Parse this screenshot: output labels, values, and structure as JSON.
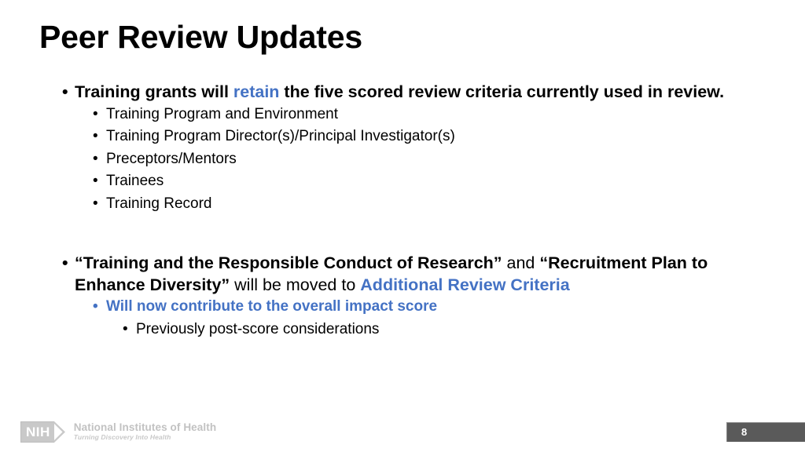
{
  "slide": {
    "title": "Peer Review Updates",
    "accent_color": "#4472C4",
    "text_color": "#000000",
    "background": "#FFFFFF"
  },
  "content": {
    "bullet1": {
      "part1": "Training grants will ",
      "accent": "retain",
      "part2": " the five scored review criteria currently used in review.",
      "sub_items": [
        "Training Program and Environment",
        "Training Program Director(s)/Principal Investigator(s)",
        "Preceptors/Mentors",
        "Trainees",
        "Training Record"
      ]
    },
    "bullet2": {
      "quote1": "“Training and the Responsible Conduct of Research”",
      "conjunction": " and ",
      "quote2": "“Recruitment Plan to Enhance Diversity”",
      "middle": " will be moved to ",
      "accent": "Additional Review Criteria",
      "sub_item": "Will now contribute to the overall impact score",
      "sub_sub_item": "Previously post-score considerations"
    }
  },
  "bullet_glyph": "•",
  "footer": {
    "logo_mark": "NIH",
    "logo_title": "National Institutes of Health",
    "logo_tagline": "Turning Discovery Into Health",
    "page_number": "8"
  }
}
